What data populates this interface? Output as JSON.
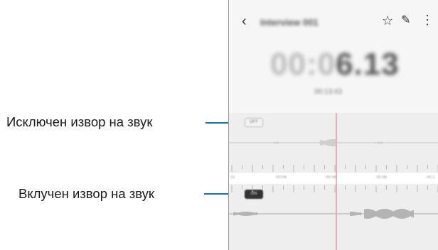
{
  "callouts": {
    "muted_label": "Исключен извор на звук",
    "unmuted_label": "Вклучен извор на звук"
  },
  "app": {
    "title": "Interview 001",
    "timer_dim": "00:0",
    "timer_bold": "6.13",
    "subtime": "00:13:43"
  },
  "tracks": {
    "badge_off": "OFF",
    "badge_on": "ON"
  },
  "timeline": {
    "tick_labels": [
      "02",
      "00:04",
      "00:06",
      "00:08",
      "00:1"
    ]
  },
  "icons": {
    "back": "chevron-left-icon",
    "star": "star-icon",
    "edit": "pencil-icon",
    "more": "more-vertical-icon"
  },
  "colors": {
    "callout_line": "#1f6fa8",
    "playhead": "#e36a6a",
    "waveform_top": "#b0b0b0",
    "waveform_bottom": "#7a7a7a"
  }
}
